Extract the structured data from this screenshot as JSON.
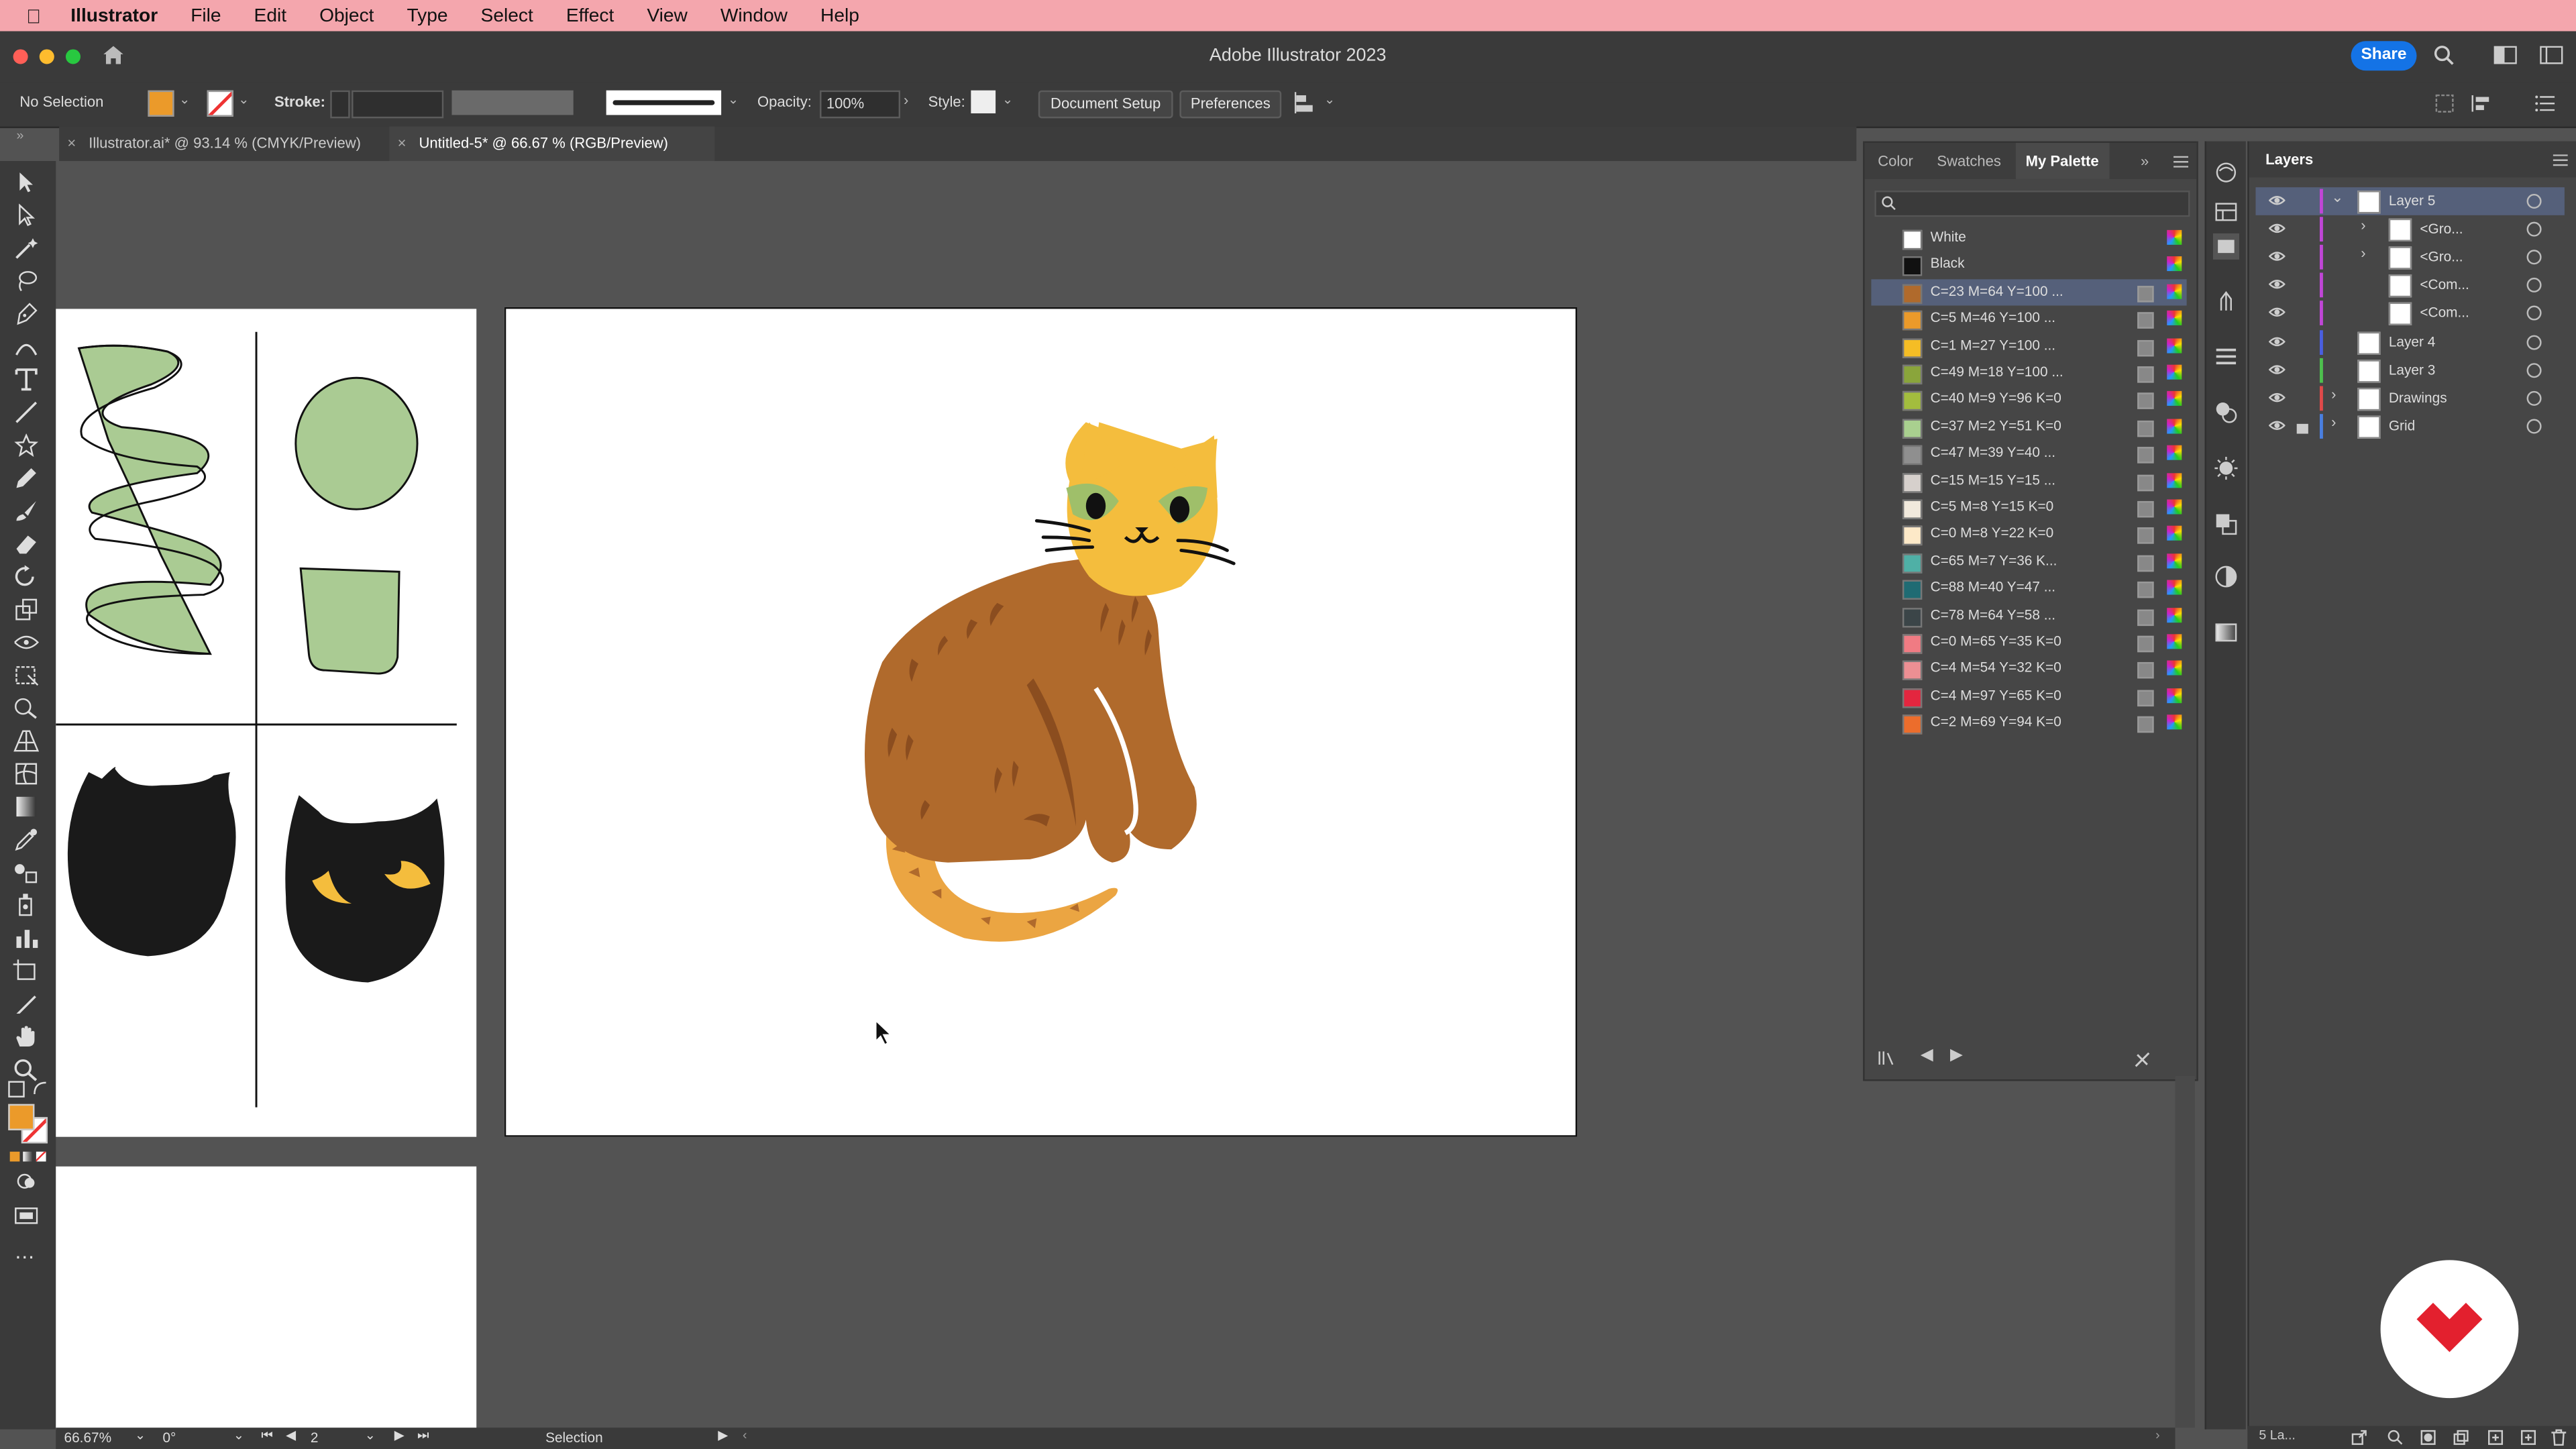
{
  "menubar": {
    "app": "Illustrator",
    "items": [
      "File",
      "Edit",
      "Object",
      "Type",
      "Select",
      "Effect",
      "View",
      "Window",
      "Help"
    ]
  },
  "window": {
    "title": "Adobe Illustrator 2023",
    "share_label": "Share"
  },
  "control": {
    "selection": "No Selection",
    "stroke_label": "Stroke:",
    "opacity_label": "Opacity:",
    "opacity_value": "100%",
    "style_label": "Style:",
    "doc_setup_label": "Document Setup",
    "preferences_label": "Preferences"
  },
  "tabs": [
    {
      "label": "Illustrator.ai* @ 93.14 % (CMYK/Preview)"
    },
    {
      "label": "Untitled-5* @ 66.67 % (RGB/Preview)"
    }
  ],
  "palette_panel": {
    "tabs": [
      "Color",
      "Swatches",
      "My Palette"
    ],
    "active_tab": "My Palette",
    "swatches": [
      {
        "name": "White",
        "color": "#ffffff"
      },
      {
        "name": "Black",
        "color": "#111111"
      },
      {
        "name": "C=23 M=64 Y=100 ...",
        "color": "#b06a2c"
      },
      {
        "name": "C=5 M=46 Y=100 ...",
        "color": "#eb9a2a"
      },
      {
        "name": "C=1 M=27 Y=100 ...",
        "color": "#f5bd25"
      },
      {
        "name": "C=49 M=18 Y=100 ...",
        "color": "#8aa53b"
      },
      {
        "name": "C=40 M=9 Y=96 K=0",
        "color": "#a3bd3e"
      },
      {
        "name": "C=37 M=2 Y=51 K=0",
        "color": "#a9d08f"
      },
      {
        "name": "C=47 M=39 Y=40 ...",
        "color": "#8f8f8f"
      },
      {
        "name": "C=15 M=15 Y=15 ...",
        "color": "#d6d0cc"
      },
      {
        "name": "C=5 M=8 Y=15 K=0",
        "color": "#f1e9dc"
      },
      {
        "name": "C=0 M=8 Y=22 K=0",
        "color": "#fde9c8"
      },
      {
        "name": "C=65 M=7 Y=36 K...",
        "color": "#4fb0a6"
      },
      {
        "name": "C=88 M=40 Y=47 ...",
        "color": "#1f6b73"
      },
      {
        "name": "C=78 M=64 Y=58 ...",
        "color": "#3b4548"
      },
      {
        "name": "C=0 M=65 Y=35 K=0",
        "color": "#f07b83"
      },
      {
        "name": "C=4 M=54 Y=32 K=0",
        "color": "#ec8f93"
      },
      {
        "name": "C=4 M=97 Y=65 K=0",
        "color": "#e3263f"
      },
      {
        "name": "C=2 M=69 Y=94 K=0",
        "color": "#ec6d2c"
      }
    ]
  },
  "layers_panel": {
    "title": "Layers",
    "rows": [
      {
        "name": "Layer 5",
        "bar": "#c046d6",
        "indent": 0,
        "selected": true,
        "expanded": true
      },
      {
        "name": "<Gro...",
        "bar": "#c046d6",
        "indent": 1,
        "selected": false
      },
      {
        "name": "<Gro...",
        "bar": "#c046d6",
        "indent": 1,
        "selected": false
      },
      {
        "name": "<Com...",
        "bar": "#c046d6",
        "indent": 1,
        "selected": false
      },
      {
        "name": "<Com...",
        "bar": "#c046d6",
        "indent": 1,
        "selected": false
      },
      {
        "name": "Layer 4",
        "bar": "#4a5fe0",
        "indent": 0,
        "selected": false
      },
      {
        "name": "Layer 3",
        "bar": "#4ec04e",
        "indent": 0,
        "selected": false
      },
      {
        "name": "Drawings",
        "bar": "#e04a4a",
        "indent": 0,
        "selected": false
      },
      {
        "name": "Grid",
        "bar": "#4a7fe0",
        "indent": 0,
        "selected": false
      }
    ],
    "footer_count": "5 La..."
  },
  "status": {
    "zoom": "66.67%",
    "rotation": "0°",
    "artboard": "2",
    "tool": "Selection"
  },
  "colors": {
    "cat_body": "#b06a2c",
    "cat_dark": "#8b4d1f",
    "cat_head": "#f4bd3d",
    "cat_tail": "#eba542",
    "eye_green": "#9fbf6a",
    "sage": "#aacb93",
    "badge_red": "#e3202e"
  }
}
